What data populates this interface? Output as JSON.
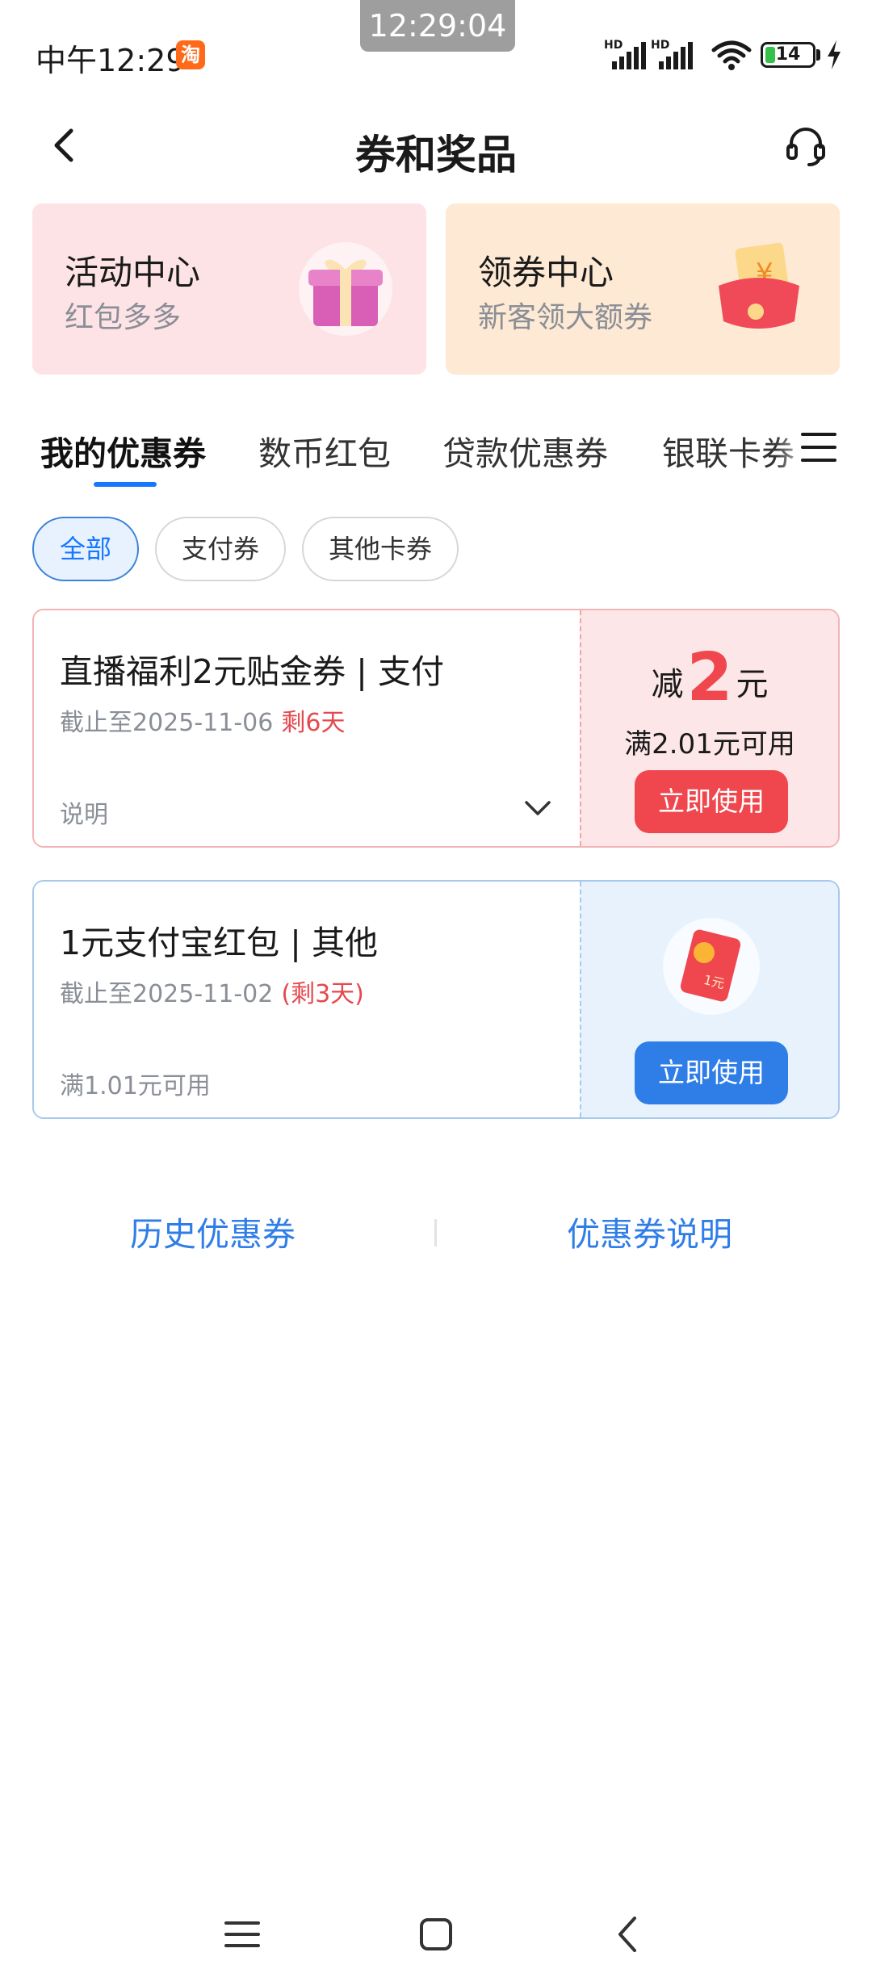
{
  "status_bar": {
    "time": "中午12:29",
    "app_icon_text": "淘",
    "overlay_clock": "12:29:04",
    "network_labels": [
      "HD",
      "HD"
    ],
    "battery": "14"
  },
  "header": {
    "title": "券和奖品"
  },
  "promos": [
    {
      "title": "活动中心",
      "subtitle": "红包多多",
      "icon": "gift-box-icon"
    },
    {
      "title": "领券中心",
      "subtitle": "新客领大额券",
      "icon": "red-envelope-icon",
      "art_text": "¥"
    }
  ],
  "tabs": [
    {
      "label": "我的优惠券",
      "active": true
    },
    {
      "label": "数币红包",
      "active": false
    },
    {
      "label": "贷款优惠券",
      "active": false
    },
    {
      "label": "银联卡券",
      "active": false
    }
  ],
  "filters": [
    {
      "label": "全部",
      "active": true
    },
    {
      "label": "支付券",
      "active": false
    },
    {
      "label": "其他卡券",
      "active": false
    }
  ],
  "coupons": [
    {
      "title": "直播福利2元贴金券 | 支付",
      "expiry": "截止至2025-11-06",
      "remaining": "剩6天",
      "footer": "说明",
      "discount_prefix": "减",
      "discount_amount": "2",
      "discount_unit": "元",
      "condition": "满2.01元可用",
      "button": "立即使用"
    },
    {
      "title": "1元支付宝红包 |  其他",
      "expiry": "截止至2025-11-02",
      "remaining": "(剩3天)",
      "footer": "满1.01元可用",
      "art_text": "1元",
      "button": "立即使用"
    }
  ],
  "links": {
    "history": "历史优惠券",
    "explanation": "优惠券说明"
  },
  "colors": {
    "accent_blue": "#1677ff",
    "coupon_red": "#f0474e",
    "link_blue": "#2f7ee8"
  }
}
